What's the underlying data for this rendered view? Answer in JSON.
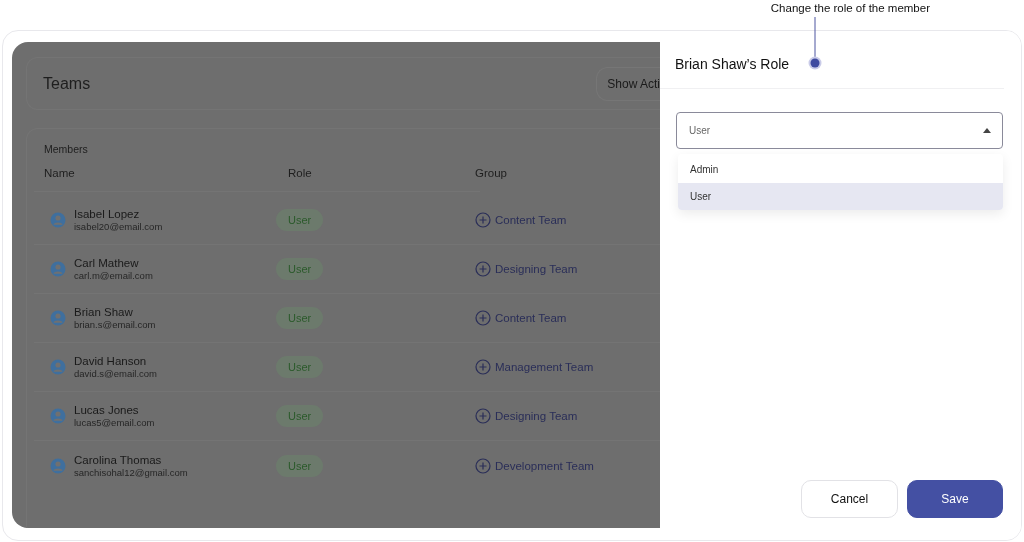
{
  "annotation": {
    "text": "Change the role of the member"
  },
  "page": {
    "title": "Teams",
    "action_button": "Show Acti"
  },
  "members": {
    "title": "Members",
    "columns": [
      "Name",
      "Role",
      "Group"
    ],
    "rows": [
      {
        "name": "Isabel Lopez",
        "email": "isabel20@email.com",
        "role": "User",
        "group": "Content Team"
      },
      {
        "name": "Carl Mathew",
        "email": "carl.m@email.com",
        "role": "User",
        "group": "Designing Team"
      },
      {
        "name": "Brian Shaw",
        "email": "brian.s@email.com",
        "role": "User",
        "group": "Content Team"
      },
      {
        "name": "David Hanson",
        "email": "david.s@email.com",
        "role": "User",
        "group": "Management Team"
      },
      {
        "name": "Lucas Jones",
        "email": "lucas5@email.com",
        "role": "User",
        "group": "Designing Team"
      },
      {
        "name": "Carolina Thomas",
        "email": "sanchisohal12@gmail.com",
        "role": "User",
        "group": "Development Team"
      }
    ]
  },
  "drawer": {
    "title": "Brian Shaw’s Role",
    "select": {
      "value": "User",
      "expanded": true
    },
    "options": [
      {
        "label": "Admin",
        "selected": false
      },
      {
        "label": "User",
        "selected": true
      }
    ],
    "buttons": [
      {
        "label": "Cancel",
        "kind": "secondary"
      },
      {
        "label": "Save",
        "kind": "primary"
      }
    ]
  }
}
